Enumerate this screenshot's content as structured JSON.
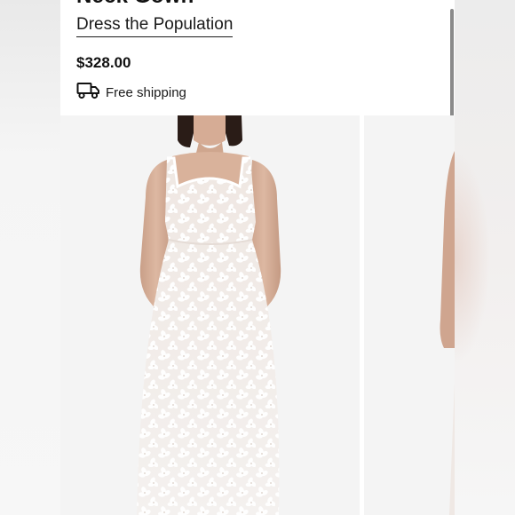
{
  "product": {
    "title": "Neck Gown",
    "brand_link": "Dress the Population",
    "price": "$328.00",
    "shipping_label": "Free shipping",
    "shipping_icon": "truck-icon"
  },
  "gallery": {
    "images": [
      {
        "name": "model-white-floral-lace-gown"
      },
      {
        "name": "model-gown-partial-next"
      }
    ]
  },
  "colors": {
    "text": "#111111",
    "background": "#ffffff",
    "scrollbar": "#8a8a8a"
  }
}
